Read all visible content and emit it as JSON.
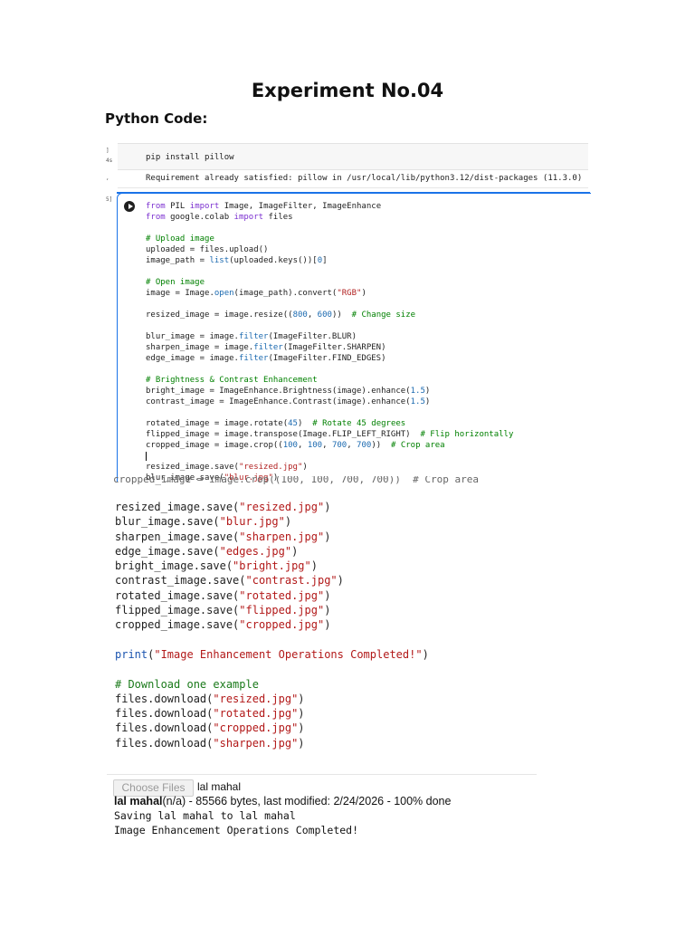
{
  "document": {
    "title": "Experiment No.04",
    "subtitle": "Python Code:"
  },
  "colab": {
    "cell1": {
      "prompt": "]",
      "prompt_sub": "4s",
      "code": "pip install pillow",
      "output_marker": ",",
      "output": "Requirement already satisfied: pillow in /usr/local/lib/python3.12/dist-packages (11.3.0)"
    },
    "cell2": {
      "prompt": "5]",
      "lines": [
        [
          {
            "t": "from ",
            "c": "kw"
          },
          {
            "t": "PIL ",
            "c": ""
          },
          {
            "t": "import ",
            "c": "kw"
          },
          {
            "t": "Image, ImageFilter, ImageEnhance",
            "c": ""
          }
        ],
        [
          {
            "t": "from ",
            "c": "kw"
          },
          {
            "t": "google.colab ",
            "c": ""
          },
          {
            "t": "import ",
            "c": "kw"
          },
          {
            "t": "files",
            "c": ""
          }
        ],
        [],
        [
          {
            "t": "# Upload image",
            "c": "cm"
          }
        ],
        [
          {
            "t": "uploaded = files.upload()",
            "c": ""
          }
        ],
        [
          {
            "t": "image_path = ",
            "c": ""
          },
          {
            "t": "list",
            "c": "nm"
          },
          {
            "t": "(uploaded.keys())[",
            "c": ""
          },
          {
            "t": "0",
            "c": "nm"
          },
          {
            "t": "]",
            "c": ""
          }
        ],
        [],
        [
          {
            "t": "# Open image",
            "c": "cm"
          }
        ],
        [
          {
            "t": "image = Image.",
            "c": ""
          },
          {
            "t": "open",
            "c": "nm"
          },
          {
            "t": "(image_path).convert(",
            "c": ""
          },
          {
            "t": "\"RGB\"",
            "c": "st"
          },
          {
            "t": ")",
            "c": ""
          }
        ],
        [],
        [
          {
            "t": "resized_image = image.resize((",
            "c": ""
          },
          {
            "t": "800",
            "c": "nm"
          },
          {
            "t": ", ",
            "c": ""
          },
          {
            "t": "600",
            "c": "nm"
          },
          {
            "t": "))  ",
            "c": ""
          },
          {
            "t": "# Change size",
            "c": "cm"
          }
        ],
        [],
        [
          {
            "t": "blur_image = image.",
            "c": ""
          },
          {
            "t": "filter",
            "c": "nm"
          },
          {
            "t": "(ImageFilter.BLUR)",
            "c": ""
          }
        ],
        [
          {
            "t": "sharpen_image = image.",
            "c": ""
          },
          {
            "t": "filter",
            "c": "nm"
          },
          {
            "t": "(ImageFilter.SHARPEN)",
            "c": ""
          }
        ],
        [
          {
            "t": "edge_image = image.",
            "c": ""
          },
          {
            "t": "filter",
            "c": "nm"
          },
          {
            "t": "(ImageFilter.FIND_EDGES)",
            "c": ""
          }
        ],
        [],
        [
          {
            "t": "# Brightness & Contrast Enhancement",
            "c": "cm"
          }
        ],
        [
          {
            "t": "bright_image = ImageEnhance.Brightness(image).enhance(",
            "c": ""
          },
          {
            "t": "1.5",
            "c": "nm"
          },
          {
            "t": ")",
            "c": ""
          }
        ],
        [
          {
            "t": "contrast_image = ImageEnhance.Contrast(image).enhance(",
            "c": ""
          },
          {
            "t": "1.5",
            "c": "nm"
          },
          {
            "t": ")",
            "c": ""
          }
        ],
        [],
        [
          {
            "t": "rotated_image = image.rotate(",
            "c": ""
          },
          {
            "t": "45",
            "c": "nm"
          },
          {
            "t": ")  ",
            "c": ""
          },
          {
            "t": "# Rotate 45 degrees",
            "c": "cm"
          }
        ],
        [
          {
            "t": "flipped_image = image.transpose(Image.FLIP_LEFT_RIGHT)  ",
            "c": ""
          },
          {
            "t": "# Flip horizontally",
            "c": "cm"
          }
        ],
        [
          {
            "t": "cropped_image = image.crop((",
            "c": ""
          },
          {
            "t": "100",
            "c": "nm"
          },
          {
            "t": ", ",
            "c": ""
          },
          {
            "t": "100",
            "c": "nm"
          },
          {
            "t": ", ",
            "c": ""
          },
          {
            "t": "700",
            "c": "nm"
          },
          {
            "t": ", ",
            "c": ""
          },
          {
            "t": "700",
            "c": "nm"
          },
          {
            "t": "))  ",
            "c": ""
          },
          {
            "t": "# Crop area",
            "c": "cm"
          }
        ],
        [
          {
            "t": "",
            "c": "caret"
          }
        ],
        [
          {
            "t": "resized_image.save(",
            "c": ""
          },
          {
            "t": "\"resized.jpg\"",
            "c": "st"
          },
          {
            "t": ")",
            "c": ""
          }
        ],
        [
          {
            "t": "blur_image.save(",
            "c": ""
          },
          {
            "t": "\"blur.jpg\"",
            "c": "st"
          },
          {
            "t": ")",
            "c": ""
          }
        ]
      ]
    },
    "crop_edge_text": "cropped_image = image.crop((100, 100, 700, 700))  # Crop area"
  },
  "code_block": {
    "lines": [
      [
        {
          "t": "resized_image.save(",
          "c": ""
        },
        {
          "t": "\"resized.jpg\"",
          "c": "st"
        },
        {
          "t": ")",
          "c": ""
        }
      ],
      [
        {
          "t": "blur_image.save(",
          "c": ""
        },
        {
          "t": "\"blur.jpg\"",
          "c": "st"
        },
        {
          "t": ")",
          "c": ""
        }
      ],
      [
        {
          "t": "sharpen_image.save(",
          "c": ""
        },
        {
          "t": "\"sharpen.jpg\"",
          "c": "st"
        },
        {
          "t": ")",
          "c": ""
        }
      ],
      [
        {
          "t": "edge_image.save(",
          "c": ""
        },
        {
          "t": "\"edges.jpg\"",
          "c": "st"
        },
        {
          "t": ")",
          "c": ""
        }
      ],
      [
        {
          "t": "bright_image.save(",
          "c": ""
        },
        {
          "t": "\"bright.jpg\"",
          "c": "st"
        },
        {
          "t": ")",
          "c": ""
        }
      ],
      [
        {
          "t": "contrast_image.save(",
          "c": ""
        },
        {
          "t": "\"contrast.jpg\"",
          "c": "st"
        },
        {
          "t": ")",
          "c": ""
        }
      ],
      [
        {
          "t": "rotated_image.save(",
          "c": ""
        },
        {
          "t": "\"rotated.jpg\"",
          "c": "st"
        },
        {
          "t": ")",
          "c": ""
        }
      ],
      [
        {
          "t": "flipped_image.save(",
          "c": ""
        },
        {
          "t": "\"flipped.jpg\"",
          "c": "st"
        },
        {
          "t": ")",
          "c": ""
        }
      ],
      [
        {
          "t": "cropped_image.save(",
          "c": ""
        },
        {
          "t": "\"cropped.jpg\"",
          "c": "st"
        },
        {
          "t": ")",
          "c": ""
        }
      ],
      [],
      [
        {
          "t": "print",
          "c": "bl"
        },
        {
          "t": "(",
          "c": ""
        },
        {
          "t": "\"Image Enhancement Operations Completed!\"",
          "c": "st"
        },
        {
          "t": ")",
          "c": ""
        }
      ],
      [],
      [
        {
          "t": "# Download one example",
          "c": "cm"
        }
      ],
      [
        {
          "t": "files.download(",
          "c": ""
        },
        {
          "t": "\"resized.jpg\"",
          "c": "st"
        },
        {
          "t": ")",
          "c": ""
        }
      ],
      [
        {
          "t": "files.download(",
          "c": ""
        },
        {
          "t": "\"rotated.jpg\"",
          "c": "st"
        },
        {
          "t": ")",
          "c": ""
        }
      ],
      [
        {
          "t": "files.download(",
          "c": ""
        },
        {
          "t": "\"cropped.jpg\"",
          "c": "st"
        },
        {
          "t": ")",
          "c": ""
        }
      ],
      [
        {
          "t": "files.download(",
          "c": ""
        },
        {
          "t": "\"sharpen.jpg\"",
          "c": "st"
        },
        {
          "t": ")",
          "c": ""
        }
      ]
    ]
  },
  "output": {
    "choose_files_label": "Choose Files",
    "selected_file": "lal mahal",
    "file_info_name": "lal mahal",
    "file_info_rest": "(n/a) - 85566 bytes, last modified: 2/24/2026 - 100% done",
    "saving_line": "Saving lal mahal to lal mahal",
    "completed_line": "Image Enhancement Operations Completed!"
  }
}
